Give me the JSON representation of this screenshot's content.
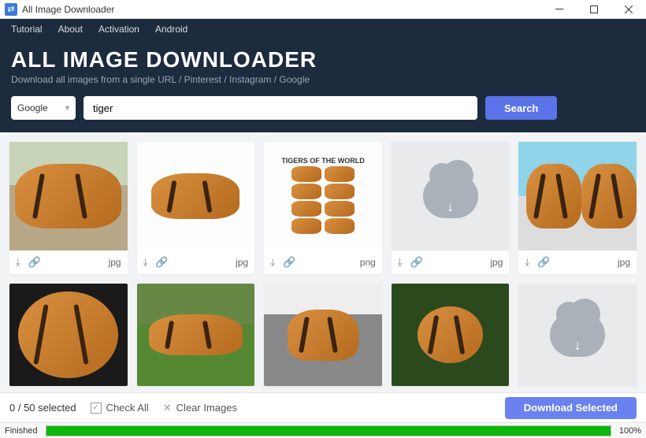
{
  "window": {
    "title": "All Image Downloader"
  },
  "menu": {
    "items": [
      "Tutorial",
      "About",
      "Activation",
      "Android"
    ]
  },
  "header": {
    "title": "ALL IMAGE DOWNLOADER",
    "subtitle": "Download all images from a single URL / Pinterest / Instagram / Google"
  },
  "search": {
    "source": "Google",
    "query": "tiger",
    "button": "Search"
  },
  "results": [
    {
      "ext": "jpg",
      "kind": "zoo"
    },
    {
      "ext": "jpg",
      "kind": "whitebg"
    },
    {
      "ext": "png",
      "kind": "world"
    },
    {
      "ext": "jpg",
      "kind": "placeholder"
    },
    {
      "ext": "jpg",
      "kind": "pool"
    },
    {
      "ext": "",
      "kind": "dark"
    },
    {
      "ext": "",
      "kind": "grass"
    },
    {
      "ext": "",
      "kind": "rock"
    },
    {
      "ext": "",
      "kind": "green"
    },
    {
      "ext": "",
      "kind": "placeholder"
    }
  ],
  "selection": {
    "count_text": "0 / 50 selected",
    "check_all": "Check All",
    "clear": "Clear Images",
    "download": "Download Selected"
  },
  "status": {
    "text": "Finished",
    "percent": 100,
    "percent_text": "100%"
  },
  "tigers_world_title": "TIGERS OF THE WORLD"
}
